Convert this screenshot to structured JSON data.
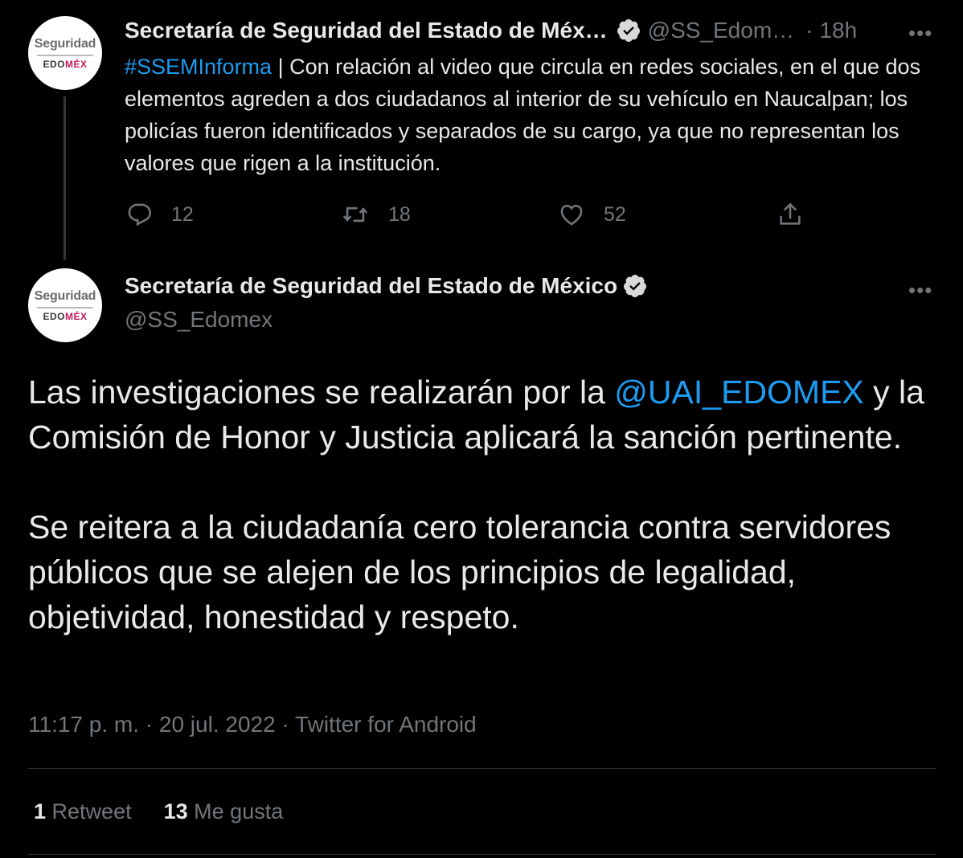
{
  "account": {
    "name": "Secretaría de Seguridad del Estado de México",
    "name_truncated": "Secretaría de Seguridad del Estado de Méx…",
    "handle_truncated": "@SS_Edom…",
    "handle": "@SS_Edomex",
    "avatar_top": "Seguridad",
    "avatar_bottom_a": "EDO",
    "avatar_bottom_b": "MÉX"
  },
  "tweet1": {
    "time_sep": "·",
    "time": "18h",
    "hashtag": "#SSEMInforma",
    "text": " | Con relación al video que circula en redes sociales, en el que dos elementos agreden a dos ciudadanos al interior de su vehículo en Naucalpan; los policías fueron identificados y separados de su cargo, ya que no representan los valores que rigen a la institución.",
    "replies": "12",
    "retweets": "18",
    "likes": "52"
  },
  "tweet2": {
    "body_p1_a": "Las investigaciones se realizarán por la ",
    "mention": "@UAI_EDOMEX",
    "body_p1_b": " y la Comisión de Honor y Justicia aplicará la sanción pertinente.",
    "body_p2": "Se reitera a la ciudadanía cero tolerancia contra servidores públicos que se alejen de los principios de legalidad, objetividad, honestidad y respeto.",
    "meta": "11:17 p. m. · 20 jul. 2022 · Twitter for Android",
    "retweet_count": "1",
    "retweet_label": "Retweet",
    "like_count": "13",
    "like_label": "Me gusta"
  },
  "more_glyph": "•••",
  "colors": {
    "background": "#000000",
    "accent": "#1d9bf0",
    "muted": "#71767b",
    "text": "#e7e9ea"
  }
}
